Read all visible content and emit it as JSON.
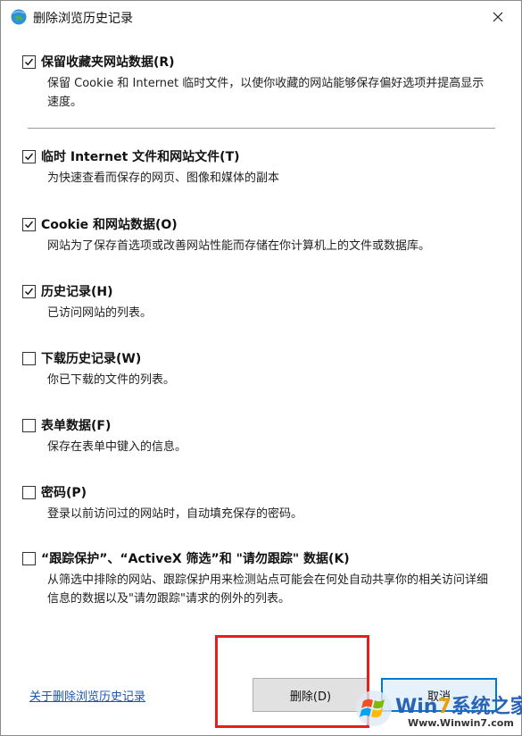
{
  "window": {
    "title": "删除浏览历史记录",
    "close_glyph": "✕"
  },
  "options": [
    {
      "label": "保留收藏夹网站数据(R)",
      "desc": "保留 Cookie 和 Internet 临时文件，以使你收藏的网站能够保存偏好选项并提高显示速度。",
      "checked": true
    },
    {
      "label": "临时 Internet 文件和网站文件(T)",
      "desc": "为快速查看而保存的网页、图像和媒体的副本",
      "checked": true
    },
    {
      "label": "Cookie 和网站数据(O)",
      "desc": "网站为了保存首选项或改善网站性能而存储在你计算机上的文件或数据库。",
      "checked": true
    },
    {
      "label": "历史记录(H)",
      "desc": "已访问网站的列表。",
      "checked": true
    },
    {
      "label": "下载历史记录(W)",
      "desc": "你已下载的文件的列表。",
      "checked": false
    },
    {
      "label": "表单数据(F)",
      "desc": "保存在表单中键入的信息。",
      "checked": false
    },
    {
      "label": "密码(P)",
      "desc": "登录以前访问过的网站时，自动填充保存的密码。",
      "checked": false
    },
    {
      "label": "“跟踪保护”、“ActiveX 筛选”和 \"请勿跟踪\" 数据(K)",
      "desc": "从筛选中排除的网站、跟踪保护用来检测站点可能会在何处自动共享你的相关访问详细信息的数据以及\"请勿跟踪\"请求的例外的列表。",
      "checked": false
    }
  ],
  "footer": {
    "help_link": "关于删除浏览历史记录",
    "delete_label": "删除(D)",
    "cancel_label": "取消"
  },
  "watermark": {
    "brand_prefix": "Win",
    "brand_seven": "7",
    "brand_suffix": "系统之家",
    "url": "Www.Winwin7.com"
  },
  "colors": {
    "link": "#1a56b8",
    "highlight": "#e2201c",
    "cancel_border": "#0078d7"
  }
}
